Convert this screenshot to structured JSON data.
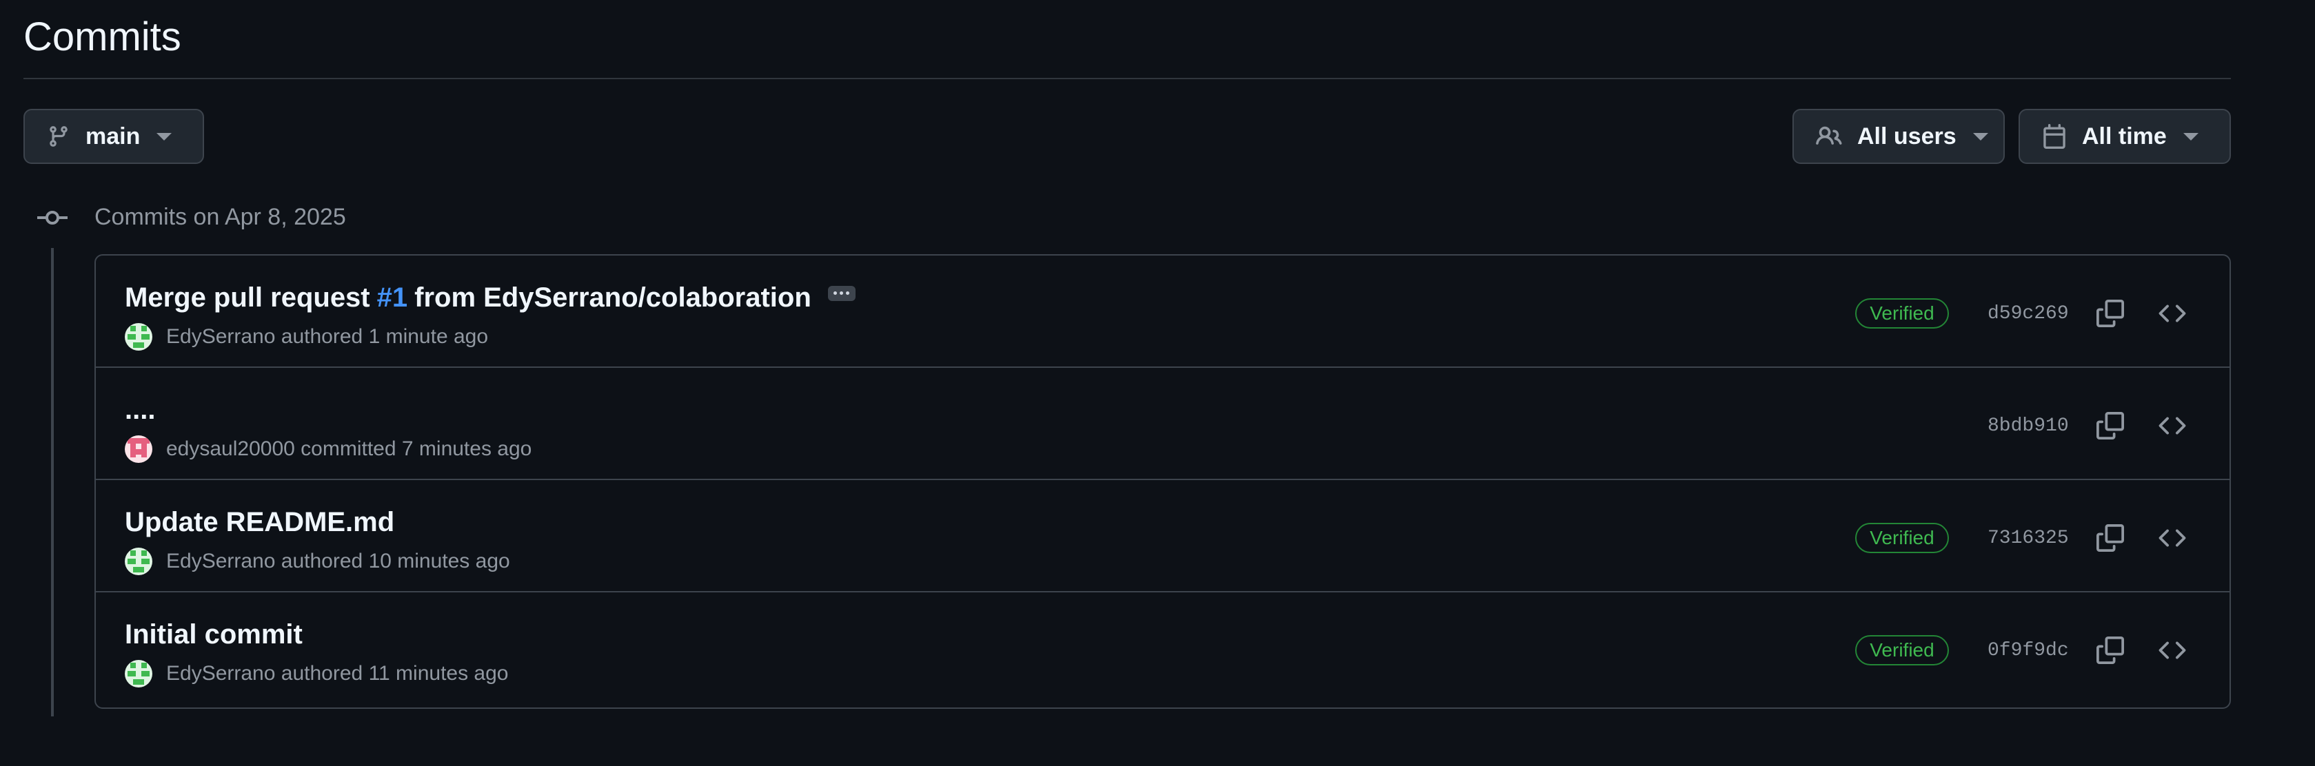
{
  "page": {
    "title": "Commits"
  },
  "filters": {
    "branch": {
      "label": "main",
      "icon": "git-branch-icon"
    },
    "users": {
      "label": "All users",
      "icon": "people-icon"
    },
    "time": {
      "label": "All time",
      "icon": "calendar-icon"
    }
  },
  "group": {
    "heading": "Commits on Apr 8, 2025",
    "icon": "git-commit-icon"
  },
  "commits": [
    {
      "title_prefix": "Merge pull request",
      "pr_link": "#1",
      "title_suffix": "from EdySerrano/colaboration",
      "author": "EdySerrano",
      "action": "authored",
      "time": "1 minute ago",
      "verified": "Verified",
      "sha": "d59c269",
      "avatar_color": "#3fb950"
    },
    {
      "title": "....",
      "author": "edysaul20000",
      "action": "committed",
      "time": "7 minutes ago",
      "sha": "8bdb910",
      "avatar_color": "#e55f7e"
    },
    {
      "title": "Update README.md",
      "author": "EdySerrano",
      "action": "authored",
      "time": "10 minutes ago",
      "verified": "Verified",
      "sha": "7316325",
      "avatar_color": "#3fb950"
    },
    {
      "title": "Initial commit",
      "author": "EdySerrano",
      "action": "authored",
      "time": "11 minutes ago",
      "verified": "Verified",
      "sha": "0f9f9dc",
      "avatar_color": "#3fb950"
    }
  ],
  "icons": {
    "copy": "copy-icon",
    "code": "code-icon"
  }
}
